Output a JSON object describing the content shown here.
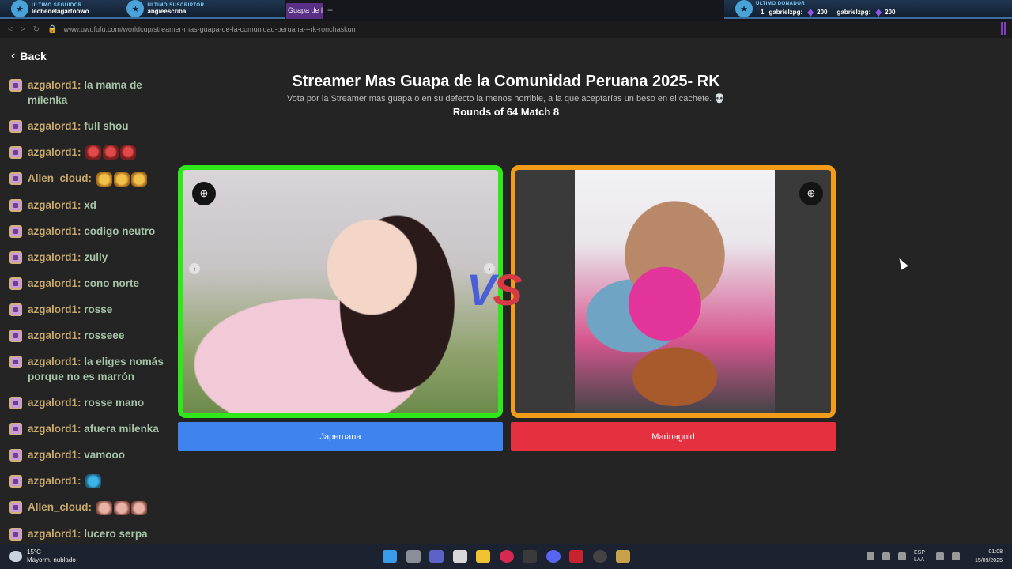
{
  "overlay": {
    "follower_title": "ULTIMO SEGUIDOR",
    "follower_name": "lechedelagartoowo",
    "subscriber_title": "ULTIMO SUSCRIPTOR",
    "subscriber_name": "angieescriba",
    "donor_title": "ULTIMO DONADOR",
    "donor_rank": "1",
    "donor_entries": [
      {
        "name": "gabrielzpg:",
        "amount": "200"
      },
      {
        "name": "gabrielzpg:",
        "amount": "200"
      }
    ]
  },
  "browser": {
    "tab_label": "Guapa de l",
    "url": "www.uwufufu.com/worldcup/streamer-mas-guapa-de-la-comunidad-peruana---rk-ronchaskun"
  },
  "page": {
    "back_label": "Back",
    "title": "Streamer Mas Guapa de la Comunidad Peruana 2025- RK",
    "subtitle": "Vota por la Streamer mas guapa o en su defecto la menos horrible, a la que aceptarías un beso en el cachete. 💀",
    "round": "Rounds of 64 Match 8",
    "vs_v": "V",
    "vs_s": "S",
    "left_choice": "Japeruana",
    "right_choice": "Marinagold",
    "left_border_color": "#2ee81a",
    "right_border_color": "#f39c1a",
    "left_button_color": "#3f83ee",
    "right_button_color": "#e5303f"
  },
  "chat": {
    "messages": [
      {
        "user": "azgalord1:",
        "text": "la mama de milenka"
      },
      {
        "user": "azgalord1:",
        "text": "full shou"
      },
      {
        "user": "azgalord1:",
        "text": ""
      },
      {
        "user": "Allen_cloud:",
        "text": ""
      },
      {
        "user": "azgalord1:",
        "text": "xd"
      },
      {
        "user": "azgalord1:",
        "text": "codigo neutro"
      },
      {
        "user": "azgalord1:",
        "text": "zully"
      },
      {
        "user": "azgalord1:",
        "text": "cono norte"
      },
      {
        "user": "azgalord1:",
        "text": "rosse"
      },
      {
        "user": "azgalord1:",
        "text": "rosseee"
      },
      {
        "user": "azgalord1:",
        "text": "la eliges nomás porque no es marrón"
      },
      {
        "user": "azgalord1:",
        "text": "rosse mano"
      },
      {
        "user": "azgalord1:",
        "text": "afuera milenka"
      },
      {
        "user": "azgalord1:",
        "text": "vamooo"
      },
      {
        "user": "azgalord1:",
        "text": ""
      },
      {
        "user": "Allen_cloud:",
        "text": ""
      },
      {
        "user": "azgalord1:",
        "text": "lucero serpa"
      }
    ]
  },
  "taskbar": {
    "temperature": "15°C",
    "weather": "Mayorm. nublado",
    "lang_top": "ESP",
    "lang_bottom": "LAA",
    "time": "01:08",
    "date": "15/09/2025"
  }
}
